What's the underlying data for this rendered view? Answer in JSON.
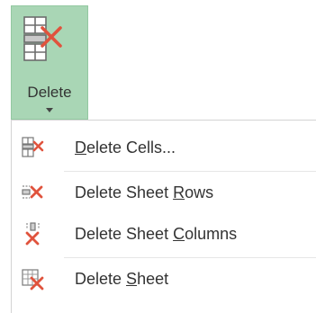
{
  "ribbon_button": {
    "label": "Delete",
    "icon": "delete-cells-icon",
    "background": "#a9d6b5",
    "accent_red": "#e0533d"
  },
  "menu": {
    "items": [
      {
        "pre": "",
        "access": "D",
        "post": "elete Cells...",
        "icon": "delete-cells-icon"
      },
      {
        "pre": "Delete Sheet ",
        "access": "R",
        "post": "ows",
        "icon": "delete-rows-icon"
      },
      {
        "pre": "Delete Sheet ",
        "access": "C",
        "post": "olumns",
        "icon": "delete-columns-icon"
      },
      {
        "pre": "Delete ",
        "access": "S",
        "post": "heet",
        "icon": "delete-sheet-icon"
      }
    ]
  }
}
